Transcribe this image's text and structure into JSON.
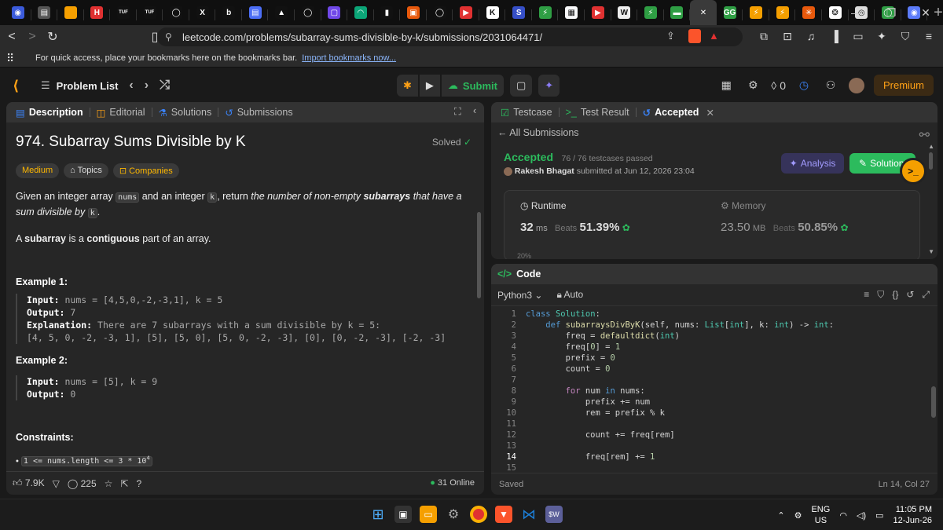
{
  "browser": {
    "tabs": [
      {
        "icon": "tab-icon-1",
        "color": "#3b5bdb",
        "glyph": "◉"
      },
      {
        "icon": "tab-icon-2",
        "color": "#555",
        "glyph": "▤"
      },
      {
        "icon": "tab-icon-3",
        "color": "#f59f00",
        "glyph": ""
      },
      {
        "icon": "tab-icon-4",
        "color": "#e03131",
        "glyph": "H"
      },
      {
        "icon": "tab-icon-5",
        "color": "#111",
        "glyph": "TUF"
      },
      {
        "icon": "tab-icon-6",
        "color": "#111",
        "glyph": "TUF"
      },
      {
        "icon": "github-icon",
        "color": "#111",
        "glyph": "◯"
      },
      {
        "icon": "x-icon",
        "color": "#111",
        "glyph": "X"
      },
      {
        "icon": "tab-icon-b",
        "color": "#111",
        "glyph": "b"
      },
      {
        "icon": "docs-icon",
        "color": "#4c6ef5",
        "glyph": "▤"
      },
      {
        "icon": "tab-icon-a",
        "color": "#111",
        "glyph": "▲"
      },
      {
        "icon": "github-icon",
        "color": "#111",
        "glyph": "◯"
      },
      {
        "icon": "tab-icon-twitch",
        "color": "#7048e8",
        "glyph": "▢"
      },
      {
        "icon": "tab-icon-wifi",
        "color": "#0ca678",
        "glyph": "◠"
      },
      {
        "icon": "tab-icon-gift",
        "color": "#111",
        "glyph": "▮"
      },
      {
        "icon": "tab-icon-red",
        "color": "#e8590c",
        "glyph": "▣"
      },
      {
        "icon": "github-icon",
        "color": "#111",
        "glyph": "◯"
      },
      {
        "icon": "youtube-icon",
        "color": "#e03131",
        "glyph": "▶"
      },
      {
        "icon": "tab-icon-k",
        "color": "#fff",
        "glyph": "K"
      },
      {
        "icon": "tab-icon-s",
        "color": "#364fc7",
        "glyph": "S"
      },
      {
        "icon": "tab-icon-leaf",
        "color": "#2f9e44",
        "glyph": "⚡"
      },
      {
        "icon": "tab-icon-gfg",
        "color": "#f8f9fa",
        "glyph": "▦"
      },
      {
        "icon": "youtube-icon",
        "color": "#e03131",
        "glyph": "▶"
      },
      {
        "icon": "tab-icon-w",
        "color": "#eee",
        "glyph": "W"
      },
      {
        "icon": "tab-icon-leaf",
        "color": "#2f9e44",
        "glyph": "⚡"
      },
      {
        "icon": "tab-icon-green",
        "color": "#2f9e44",
        "glyph": "▬"
      },
      {
        "icon": "close-icon",
        "color": "#3a3a3a",
        "glyph": "✕",
        "active": true
      },
      {
        "icon": "tab-icon-gfg2",
        "color": "#2f9e44",
        "glyph": "GG"
      },
      {
        "icon": "tab-icon-bolt",
        "color": "#f59f00",
        "glyph": "⚡"
      },
      {
        "icon": "tab-icon-bolt2",
        "color": "#f59f00",
        "glyph": "⚡"
      },
      {
        "icon": "tab-icon-claude",
        "color": "#e8590c",
        "glyph": "✳"
      },
      {
        "icon": "tab-icon-gpt",
        "color": "#fff",
        "glyph": "❂"
      },
      {
        "icon": "tab-icon-chrome",
        "color": "#ddd",
        "glyph": "◎"
      },
      {
        "icon": "whatsapp-icon",
        "color": "#2f9e44",
        "glyph": "◯"
      },
      {
        "icon": "tab-icon-blue",
        "color": "#5c7cfa",
        "glyph": "◉"
      }
    ],
    "url": "leetcode.com/problems/subarray-sums-divisible-by-k/submissions/2031064471/",
    "bookmarks_text": "For quick access, place your bookmarks here on the bookmarks bar.",
    "bookmarks_link": "Import bookmarks now..."
  },
  "header": {
    "problem_list": "Problem List",
    "submit": "Submit",
    "streak": "0",
    "premium": "Premium"
  },
  "left": {
    "tabs": [
      "Description",
      "Editorial",
      "Solutions",
      "Submissions"
    ],
    "title": "974. Subarray Sums Divisible by K",
    "solved": "Solved",
    "chips": [
      "Medium",
      "Topics",
      "Companies"
    ],
    "p1_pre": "Given an integer array",
    "p1_code1": "nums",
    "p1_mid": "and an integer",
    "p1_code2": "k",
    "p1_post": ", return",
    "p1_em1": "the number of non-empty",
    "p1_strong": "subarrays",
    "p1_em2": "that have a sum divisible by",
    "p1_code3": "k",
    "p2_pre": "A",
    "p2_strong1": "subarray",
    "p2_mid": "is a",
    "p2_strong2": "contiguous",
    "p2_post": "part of an array.",
    "ex1_title": "Example 1:",
    "ex1_input_label": "Input:",
    "ex1_input": "nums = [4,5,0,-2,-3,1], k = 5",
    "ex1_output_label": "Output:",
    "ex1_output": "7",
    "ex1_expl_label": "Explanation:",
    "ex1_expl": "There are 7 subarrays with a sum divisible by k = 5:",
    "ex1_list": "[4, 5, 0, -2, -3, 1], [5], [5, 0], [5, 0, -2, -3], [0], [0, -2, -3], [-2, -3]",
    "ex2_title": "Example 2:",
    "ex2_input_label": "Input:",
    "ex2_input": "nums = [5], k = 9",
    "ex2_output_label": "Output:",
    "ex2_output": "0",
    "constraints_title": "Constraints:",
    "constraint1": "1 <= nums.length <= 3 * 10",
    "constraint1_sup": "4",
    "likes": "7.9K",
    "comments": "225",
    "online": "31 Online"
  },
  "result": {
    "tabs": [
      "Testcase",
      "Test Result",
      "Accepted"
    ],
    "back": "All Submissions",
    "status": "Accepted",
    "passed": "76 / 76 testcases passed",
    "user": "Rakesh Bhagat",
    "submitted": "submitted at Jun 12, 2026 23:04",
    "analysis": "Analysis",
    "solution": "Solution",
    "runtime_label": "Runtime",
    "runtime_value": "32",
    "runtime_unit": "ms",
    "runtime_beats_label": "Beats",
    "runtime_beats": "51.39%",
    "memory_label": "Memory",
    "memory_value": "23.50",
    "memory_unit": "MB",
    "memory_beats_label": "Beats",
    "memory_beats": "50.85%",
    "pct": "20%"
  },
  "code": {
    "title": "Code",
    "lang": "Python3",
    "mode": "Auto",
    "saved": "Saved",
    "cursor": "Ln 14, Col 27",
    "lines": [
      "1",
      "2",
      "3",
      "4",
      "5",
      "6",
      "7",
      "8",
      "9",
      "10",
      "11",
      "12",
      "13",
      "14",
      "15"
    ]
  },
  "taskbar": {
    "lang1": "ENG",
    "lang2": "US",
    "time": "11:05 PM",
    "date": "12-Jun-26"
  }
}
